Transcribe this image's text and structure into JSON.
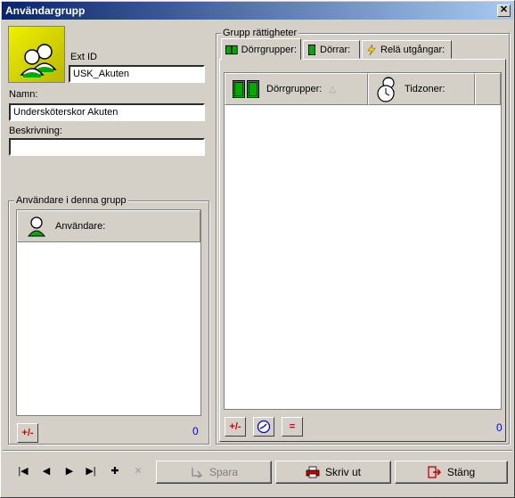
{
  "window": {
    "title": "Användargrupp",
    "close_glyph": "✕"
  },
  "left": {
    "ext_id_label": "Ext ID",
    "ext_id_value": "USK_Akuten",
    "name_label": "Namn:",
    "name_value": "Undersköterskor Akuten",
    "description_label": "Beskrivning:",
    "description_value": "",
    "users_group_title": "Användare i denna grupp",
    "users_column": "Användare:",
    "users_count": "0"
  },
  "right": {
    "group_title": "Grupp rättigheter",
    "tabs": [
      {
        "label": "Dörrgrupper:"
      },
      {
        "label": "Dörrar:"
      },
      {
        "label": "Relä utgångar:"
      }
    ],
    "columns": {
      "door_groups": "Dörrgrupper:",
      "time_zones": "Tidzoner:"
    },
    "sort_indicator": "△",
    "count": "0"
  },
  "tools": {
    "add_remove": "+/-",
    "equals": "="
  },
  "nav": {
    "first": "|◀",
    "prev": "◀",
    "next": "▶",
    "last": "▶|",
    "add": "✚",
    "delete": "✕"
  },
  "buttons": {
    "save": "Spara",
    "print": "Skriv ut",
    "close": "Stäng"
  },
  "colors": {
    "title_start": "#0a246a",
    "title_end": "#a6caf0",
    "count": "#0000ff",
    "avatar_bg": "#d8d800"
  }
}
